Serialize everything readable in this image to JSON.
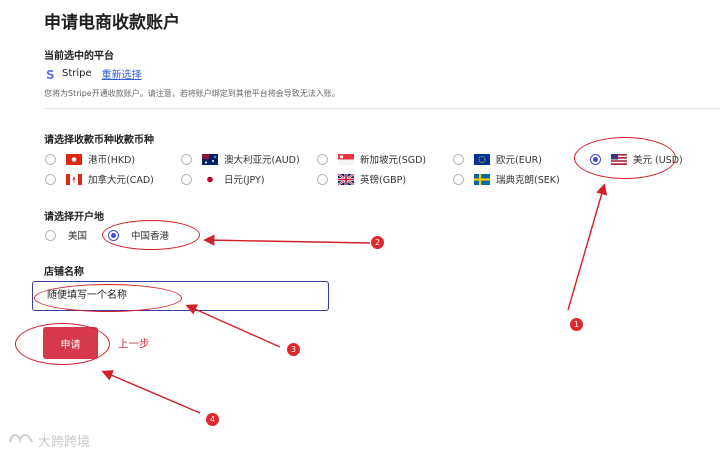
{
  "page": {
    "title": "申请电商收款账户"
  },
  "platform": {
    "section_label": "当前选中的平台",
    "name": "Stripe",
    "reselect_label": "重新选择",
    "notice": "您将为Stripe开通收款账户。请注意，若将账户绑定到其他平台将会导致无法入账。"
  },
  "currency": {
    "section_label": "请选择收款币种收款币种",
    "options": [
      {
        "label": "港币(HKD)",
        "flag": "hk-flag-icon",
        "checked": false
      },
      {
        "label": "澳大利亚元(AUD)",
        "flag": "au-flag-icon",
        "checked": false
      },
      {
        "label": "新加坡元(SGD)",
        "flag": "sg-flag-icon",
        "checked": false
      },
      {
        "label": "欧元(EUR)",
        "flag": "eu-flag-icon",
        "checked": false
      },
      {
        "label": "美元 (USD)",
        "flag": "us-flag-icon",
        "checked": true
      },
      {
        "label": "加拿大元(CAD)",
        "flag": "ca-flag-icon",
        "checked": false
      },
      {
        "label": "日元(JPY)",
        "flag": "jp-flag-icon",
        "checked": false
      },
      {
        "label": "英镑(GBP)",
        "flag": "gb-flag-icon",
        "checked": false
      },
      {
        "label": "瑞典克朗(SEK)",
        "flag": "se-flag-icon",
        "checked": false
      }
    ]
  },
  "location": {
    "section_label": "请选择开户地",
    "options": [
      {
        "label": "美国",
        "checked": false
      },
      {
        "label": "中国香港",
        "checked": true
      }
    ]
  },
  "store": {
    "section_label": "店铺名称",
    "value": "随便填写一个名称"
  },
  "actions": {
    "apply_label": "申请",
    "back_label": "上一步"
  },
  "annotations": {
    "badges": [
      "1",
      "2",
      "3",
      "4"
    ],
    "color": "#d21f2a"
  },
  "watermark": {
    "text": "大跨跨境"
  },
  "colors": {
    "accent": "#3f4bd1",
    "primary_button": "#d63a4a",
    "link": "#2f5fd0"
  }
}
